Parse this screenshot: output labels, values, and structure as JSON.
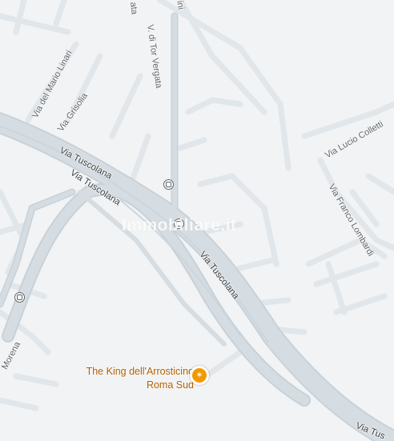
{
  "map": {
    "colors": {
      "background": "#f1f3f4",
      "road": "#d6dde2",
      "road_edge": "#c3ccd3",
      "minor_road": "#e1e6ea",
      "label": "#5f6368",
      "poi": "#b06000",
      "poi_icon": "#f29900"
    },
    "street_labels": {
      "tuscolana_1": "Via Tuscolana",
      "tuscolana_2": "Via Tuscolana",
      "tuscolana_3": "Via Tuscolana",
      "tuscolana_4": "Via Tus",
      "tor_vergata": "V. di Tor Vergata",
      "tor_vergata_top": "ata",
      "mario_linari": "Via del Mario Linari",
      "grisolia": "Via Grisolia",
      "lucio_colletti": "Via Lucio Colletti",
      "franco_lombardi": "Via Franco Lombardi",
      "morena": "Morena",
      "top_partial": "ini"
    },
    "poi": {
      "name_line1": "The King dell'Arrosticino",
      "name_line2": "Roma Sud",
      "icon": "restaurant-icon"
    },
    "transit_icons": [
      "bus-stop-icon",
      "bus-stop-icon",
      "bus-stop-icon"
    ],
    "watermark": "Immobiliare.it"
  }
}
